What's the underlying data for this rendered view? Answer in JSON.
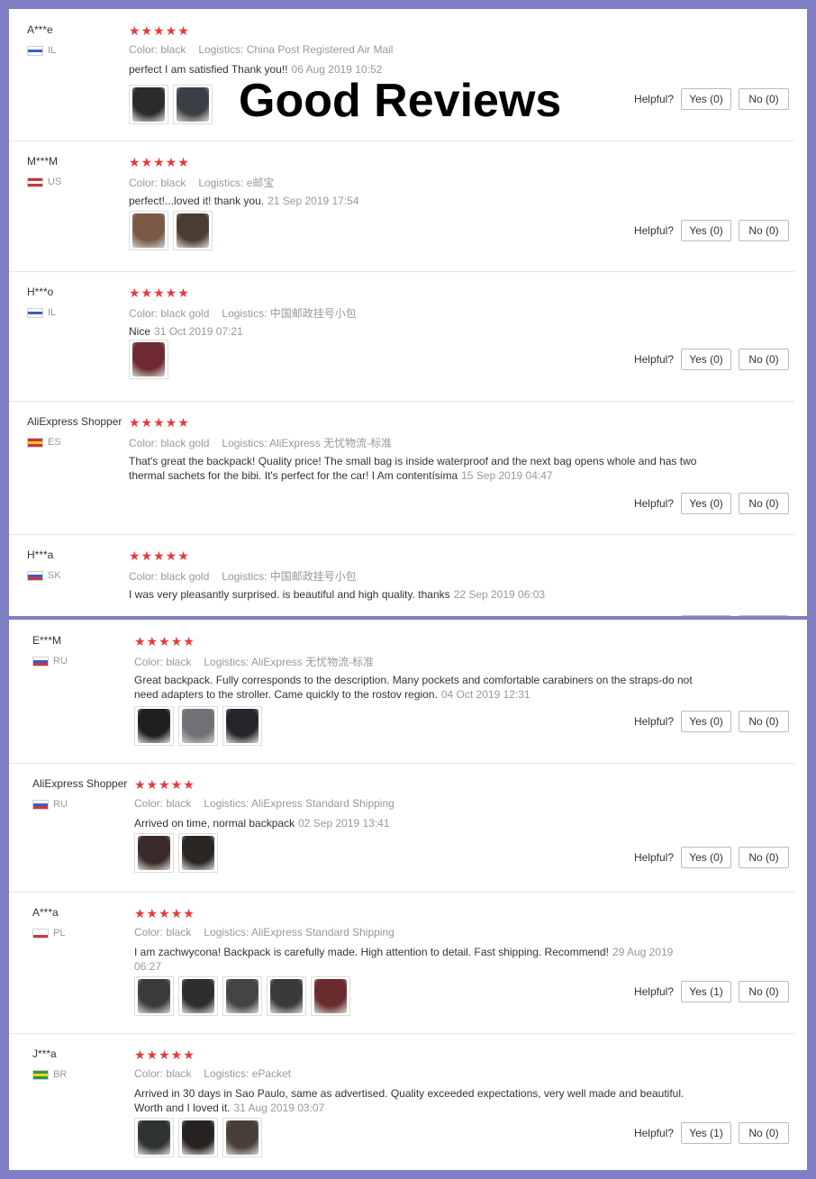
{
  "overlay_title": "Good Reviews",
  "helpful_label": "Helpful?",
  "reviews_top": [
    {
      "user": "A***e",
      "country": "IL",
      "flag": [
        "#ffffff",
        "#3b5cc6",
        "#ffffff"
      ],
      "color": "Color: black",
      "logistics": "Logistics: China Post Registered Air Mail",
      "text": "perfect I am satisfied Thank you!!",
      "date": "06 Aug 2019 10:52",
      "yes": "Yes (0)",
      "no": "No (0)",
      "thumbs": [
        "#2b2b2b",
        "#3a3f45"
      ]
    },
    {
      "user": "M***M",
      "country": "US",
      "flag": [
        "#c8383d",
        "#ffffff",
        "#c8383d"
      ],
      "color": "Color: black",
      "logistics": "Logistics: e邮宝",
      "text": "perfect!...loved it! thank you.",
      "date": "21 Sep 2019 17:54",
      "yes": "Yes (0)",
      "no": "No (0)",
      "thumbs": [
        "#7a5a44",
        "#4a3c30"
      ]
    },
    {
      "user": "H***o",
      "country": "IL",
      "flag": [
        "#ffffff",
        "#3b5cc6",
        "#ffffff"
      ],
      "color": "Color: black gold",
      "logistics": "Logistics: 中国邮政挂号小包",
      "text": "Nice",
      "date": "31 Oct 2019 07:21",
      "yes": "Yes (0)",
      "no": "No (0)",
      "thumbs": [
        "#6e2a30"
      ]
    },
    {
      "user": "AliExpress Shopper",
      "country": "ES",
      "flag": [
        "#c8383d",
        "#f2c12e",
        "#c8383d"
      ],
      "color": "Color: black gold",
      "logistics": "Logistics: AliExpress 无忧物流-标准",
      "text": "That's great the backpack! Quality price! The small bag is inside waterproof and the next bag opens whole and has two thermal sachets for the bibi. It's perfect for the car! I Am contentísima",
      "date": "15 Sep 2019 04:47",
      "yes": "Yes (0)",
      "no": "No (0)",
      "thumbs": []
    },
    {
      "user": "H***a",
      "country": "SK",
      "flag": [
        "#ffffff",
        "#3b5cc6",
        "#c8383d"
      ],
      "color": "Color: black gold",
      "logistics": "Logistics: 中国邮政挂号小包",
      "text": "I was very pleasantly surprised. is beautiful and high quality. thanks",
      "date": "22 Sep 2019 06:03",
      "yes": "",
      "no": "",
      "thumbs": []
    }
  ],
  "reviews_bottom": [
    {
      "user": "E***M",
      "country": "RU",
      "flag": [
        "#ffffff",
        "#3b5cc6",
        "#c8383d"
      ],
      "color": "Color: black",
      "logistics": "Logistics: AliExpress 无忧物流-标准",
      "text": "Great backpack. Fully corresponds to the description. Many pockets and comfortable carabiners on the straps-do not need adapters to the stroller. Came quickly to the rostov region.",
      "date": "04 Oct 2019 12:31",
      "yes": "Yes (0)",
      "no": "No (0)",
      "thumbs": [
        "#1f1f1f",
        "#6f7176",
        "#24262c"
      ]
    },
    {
      "user": "AliExpress Shopper",
      "country": "RU",
      "flag": [
        "#ffffff",
        "#3b5cc6",
        "#c8383d"
      ],
      "color": "Color: black",
      "logistics": "Logistics: AliExpress Standard Shipping",
      "text": "Arrived on time, normal backpack",
      "date": "02 Sep 2019 13:41",
      "yes": "Yes (0)",
      "no": "No (0)",
      "thumbs": [
        "#3a2a2a",
        "#2a2624"
      ]
    },
    {
      "user": "A***a",
      "country": "PL",
      "flag": [
        "#ffffff",
        "#ffffff",
        "#c8383d"
      ],
      "color": "Color: black",
      "logistics": "Logistics: AliExpress Standard Shipping",
      "text": "I am zachwycona! Backpack is carefully made. High attention to detail. Fast shipping. Recommend!",
      "date": "29 Aug 2019 06:27",
      "yes": "Yes (1)",
      "no": "No (0)",
      "thumbs": [
        "#3b3b3b",
        "#2e2e2e",
        "#444444",
        "#3a3a3a",
        "#6a2a2e"
      ]
    },
    {
      "user": "J***a",
      "country": "BR",
      "flag": [
        "#2a9a3c",
        "#f2d12e",
        "#2a9a3c"
      ],
      "color": "Color: black",
      "logistics": "Logistics: ePacket",
      "text": "Arrived in 30 days in Sao Paulo, same as advertised. Quality exceeded expectations, very well made and beautiful. Worth and I loved it.",
      "date": "31 Aug 2019 03:07",
      "yes": "Yes (1)",
      "no": "No (0)",
      "thumbs": [
        "#2d3330",
        "#262222",
        "#4a3f38"
      ]
    }
  ]
}
